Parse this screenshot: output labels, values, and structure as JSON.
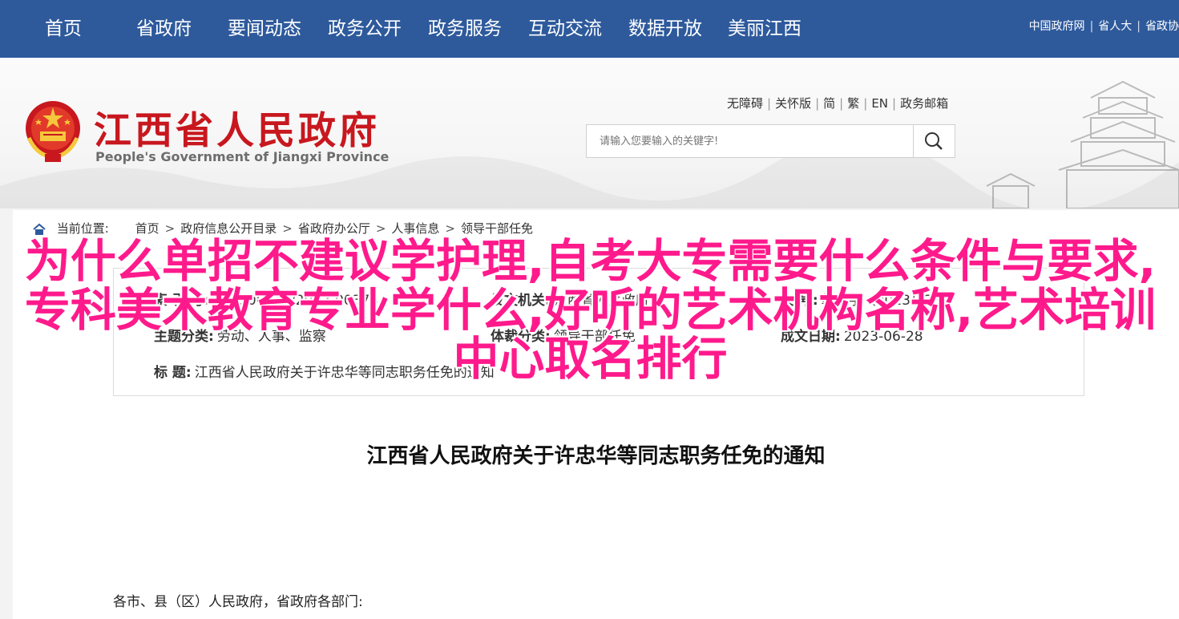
{
  "nav": {
    "items": [
      "首页",
      "省政府",
      "要闻动态",
      "政务公开",
      "政务服务",
      "互动交流",
      "数据开放",
      "美丽江西"
    ],
    "bg_color": "#2e5a9c",
    "top_links": [
      "中国政府网",
      "省人大",
      "省政协"
    ]
  },
  "header": {
    "title": "江西省人民政府",
    "subtitle": "People's Government of Jiangxi Province",
    "title_color": "#c8171e",
    "util_links": [
      "无障碍",
      "关怀版",
      "简",
      "繁",
      "EN",
      "政务邮箱"
    ],
    "search": {
      "placeholder": "请输入您要输入的关键字!",
      "icon": "search-icon"
    }
  },
  "breadcrumb": {
    "label": "当前位置:",
    "items": [
      "首页",
      "政府信息公开目录",
      "省政府办公厅",
      "人事信息",
      "领导干部任免"
    ]
  },
  "info": {
    "index_label": "索 引 号:",
    "index_value": "014500810/2023-00373",
    "issuer_label": "发文机关:",
    "issuer_value": "江西省人民政府",
    "doc_no_label": "文 号:",
    "doc_no_value": "赣府字〔2023〕38号",
    "topic_label": "主题分类:",
    "topic_value": "劳动、人事、监察",
    "genre_label": "体裁分类:",
    "genre_value": "领导干部任免",
    "date_label": "成文日期:",
    "date_value": "2023-06-28",
    "title_label": "标 题:",
    "title_value": "江西省人民政府关于许忠华等同志职务任免的通知"
  },
  "article": {
    "title": "江西省人民政府关于许忠华等同志职务任免的通知",
    "salutation": "各市、县（区）人民政府，省政府各部门:"
  },
  "overlay": {
    "text": "为什么单招不建议学护理,自考大专需要什么条件与要求,专科美术教育专业学什么,好听的艺术机构名称,艺术培训中心取名排行",
    "color": "#ff1a8c"
  }
}
